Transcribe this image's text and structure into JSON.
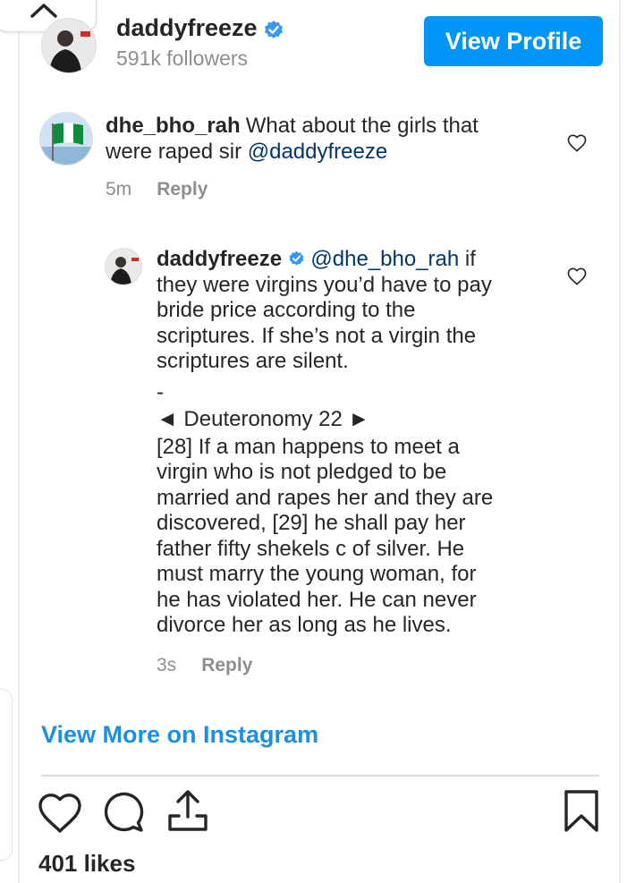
{
  "post_header": {
    "username": "daddyfreeze",
    "followers": "591k followers",
    "view_profile_label": "View Profile"
  },
  "comment": {
    "username": "dhe_bho_rah",
    "text": "What about the girls that were raped sir",
    "mention": "@daddyfreeze",
    "time": "5m",
    "reply_label": "Reply"
  },
  "reply": {
    "username": "daddyfreeze",
    "mention": "@dhe_bho_rah",
    "first_line_rest": "if",
    "lines": [
      "they were virgins you’d have to pay",
      "bride price according to the",
      "scriptures. If she’s not a virgin the",
      "scriptures are silent.",
      "-",
      "◄ Deuteronomy 22 ►",
      "[28] If a man happens to meet a",
      "virgin who is not pledged to be",
      "married and rapes her and they are",
      "discovered, [29] he shall pay her",
      "father fifty shekels c of silver. He",
      "must marry the young woman, for",
      "he has violated her. He can never",
      "divorce her as long as he lives."
    ],
    "time": "3s",
    "reply_label": "Reply"
  },
  "view_more_label": "View More on Instagram",
  "likes": "401 likes",
  "colors": {
    "accent": "#0095f6",
    "link": "#1d8fe3",
    "mention": "#00376b",
    "muted": "#8e8e8e",
    "verified": "#3897f0"
  },
  "icons": [
    "chevron-up-icon",
    "verified-badge-icon",
    "heart-icon",
    "comment-icon",
    "share-icon",
    "bookmark-icon"
  ]
}
